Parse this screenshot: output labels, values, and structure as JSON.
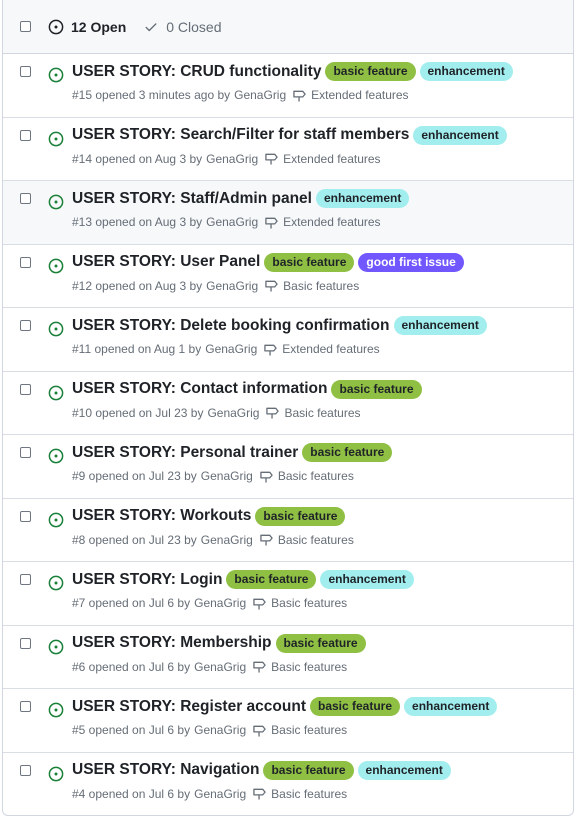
{
  "header": {
    "open_label": "12 Open",
    "closed_label": "0 Closed"
  },
  "colors": {
    "basic feature": "#8fc043",
    "enhancement": "#a2eeef",
    "good first issue": "#7057ff",
    "open_icon": "#1a7f37"
  },
  "issues": [
    {
      "title": "USER STORY: CRUD functionality",
      "labels": [
        "basic feature",
        "enhancement"
      ],
      "meta_prefix": "#15 opened 3 minutes ago by",
      "author": "GenaGrig",
      "milestone": "Extended features"
    },
    {
      "title": "USER STORY: Search/Filter for staff members",
      "labels": [
        "enhancement"
      ],
      "meta_prefix": "#14 opened on Aug 3 by",
      "author": "GenaGrig",
      "milestone": "Extended features"
    },
    {
      "title": "USER STORY: Staff/Admin panel",
      "labels": [
        "enhancement"
      ],
      "meta_prefix": "#13 opened on Aug 3 by",
      "author": "GenaGrig",
      "milestone": "Extended features"
    },
    {
      "title": "USER STORY: User Panel",
      "labels": [
        "basic feature",
        "good first issue"
      ],
      "meta_prefix": "#12 opened on Aug 3 by",
      "author": "GenaGrig",
      "milestone": "Basic features"
    },
    {
      "title": "USER STORY: Delete booking confirmation",
      "labels": [
        "enhancement"
      ],
      "meta_prefix": "#11 opened on Aug 1 by",
      "author": "GenaGrig",
      "milestone": "Extended features"
    },
    {
      "title": "USER STORY: Contact information",
      "labels": [
        "basic feature"
      ],
      "meta_prefix": "#10 opened on Jul 23 by",
      "author": "GenaGrig",
      "milestone": "Basic features"
    },
    {
      "title": "USER STORY: Personal trainer",
      "labels": [
        "basic feature"
      ],
      "meta_prefix": "#9 opened on Jul 23 by",
      "author": "GenaGrig",
      "milestone": "Basic features"
    },
    {
      "title": "USER STORY: Workouts",
      "labels": [
        "basic feature"
      ],
      "meta_prefix": "#8 opened on Jul 23 by",
      "author": "GenaGrig",
      "milestone": "Basic features"
    },
    {
      "title": "USER STORY: Login",
      "labels": [
        "basic feature",
        "enhancement"
      ],
      "meta_prefix": "#7 opened on Jul 6 by",
      "author": "GenaGrig",
      "milestone": "Basic features"
    },
    {
      "title": "USER STORY: Membership",
      "labels": [
        "basic feature"
      ],
      "meta_prefix": "#6 opened on Jul 6 by",
      "author": "GenaGrig",
      "milestone": "Basic features"
    },
    {
      "title": "USER STORY: Register account",
      "labels": [
        "basic feature",
        "enhancement"
      ],
      "meta_prefix": "#5 opened on Jul 6 by",
      "author": "GenaGrig",
      "milestone": "Basic features"
    },
    {
      "title": "USER STORY: Navigation",
      "labels": [
        "basic feature",
        "enhancement"
      ],
      "meta_prefix": "#4 opened on Jul 6 by",
      "author": "GenaGrig",
      "milestone": "Basic features"
    }
  ]
}
